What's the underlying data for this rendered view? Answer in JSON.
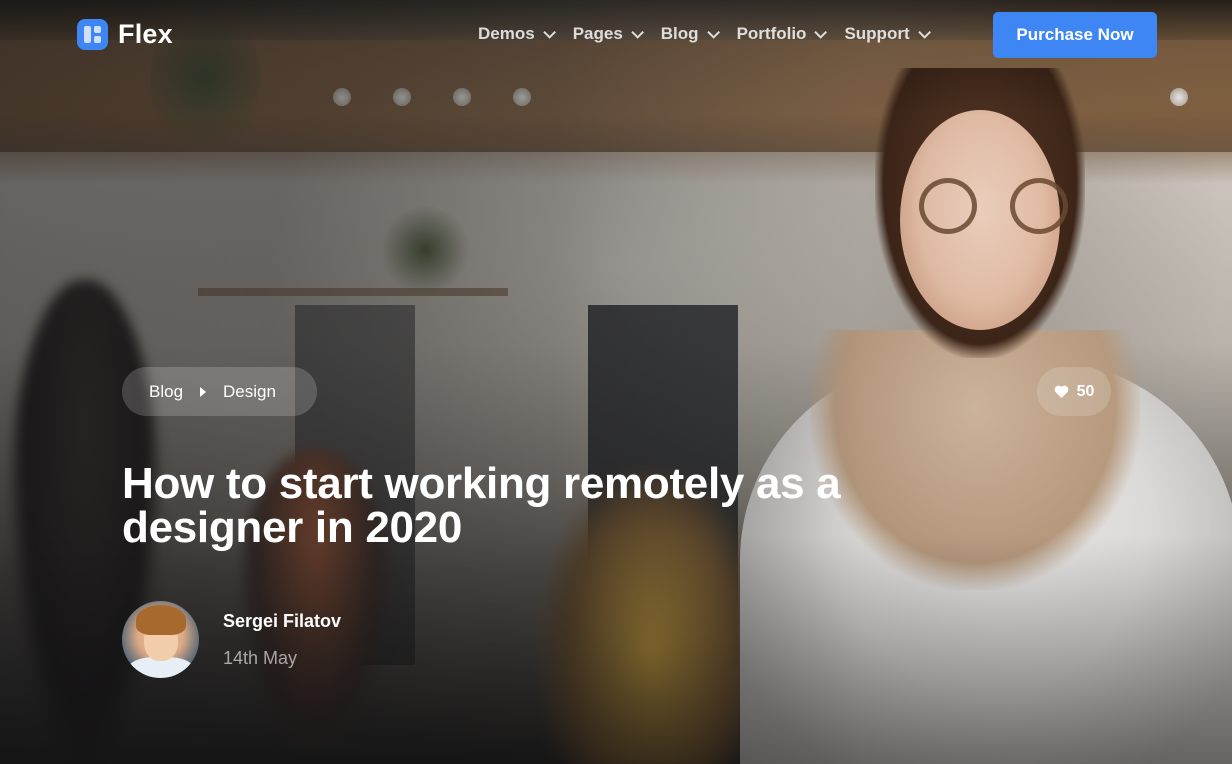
{
  "nav": {
    "logo_text": "Flex",
    "items": [
      {
        "label": "Demos"
      },
      {
        "label": "Pages"
      },
      {
        "label": "Blog"
      },
      {
        "label": "Portfolio"
      },
      {
        "label": "Support"
      }
    ],
    "cta_label": "Purchase Now"
  },
  "breadcrumb": [
    "Blog",
    "Design"
  ],
  "likes": "50",
  "post": {
    "title": "How to start working remotely as a designer in 2020",
    "author": "Sergei Filatov",
    "date": "14th May"
  },
  "colors": {
    "accent": "#3f86f5"
  }
}
